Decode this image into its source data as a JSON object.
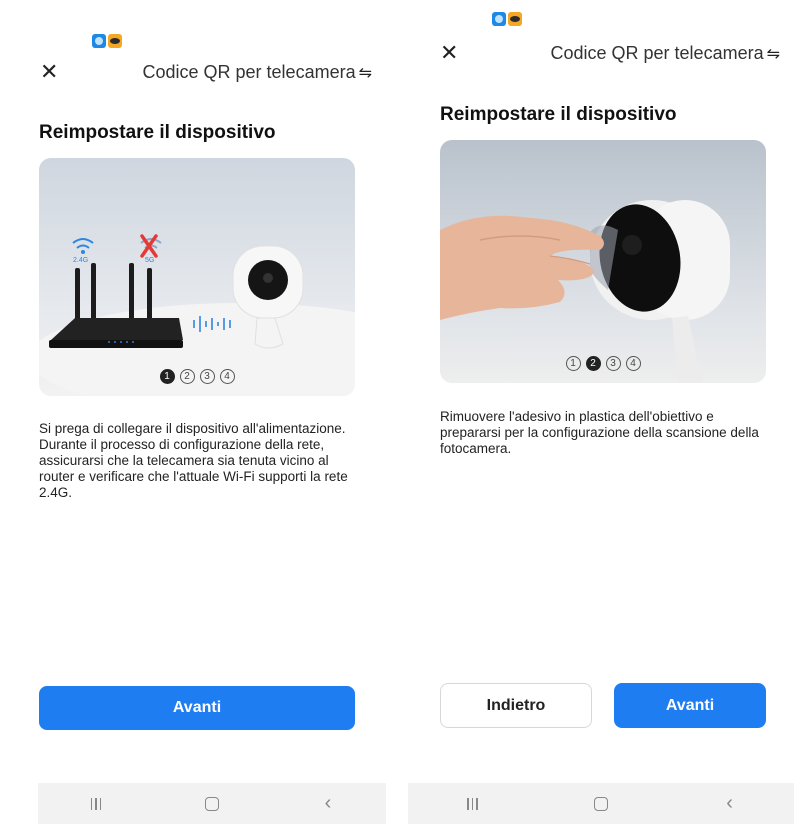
{
  "screens": [
    {
      "header_title": "Codice QR per telecamera",
      "section_title": "Reimpostare il dispositivo",
      "illustration_labels": {
        "band_24": "2.4G",
        "band_5": "5G"
      },
      "steps": [
        "1",
        "2",
        "3",
        "4"
      ],
      "active_step": 1,
      "description": "Si prega di collegare il dispositivo all'alimentazione. Durante il processo di configurazione della rete, assicurarsi che la telecamera sia tenuta vicino al router e verificare che l'attuale Wi-Fi supporti la rete 2.4G.",
      "buttons": {
        "next": "Avanti"
      }
    },
    {
      "header_title": "Codice QR per telecamera",
      "section_title": "Reimpostare il dispositivo",
      "steps": [
        "1",
        "2",
        "3",
        "4"
      ],
      "active_step": 2,
      "description": "Rimuovere l'adesivo in plastica dell'obiettivo e prepararsi per la configurazione della scansione della fotocamera.",
      "buttons": {
        "back": "Indietro",
        "next": "Avanti"
      }
    }
  ],
  "icons": {
    "close": "close-icon",
    "switch": "switch-arrows-icon",
    "recents": "recents-icon",
    "home": "home-icon",
    "back": "back-chevron-icon"
  },
  "colors": {
    "primary": "#1f7df2",
    "nav_bar": "#f2f2f2"
  }
}
